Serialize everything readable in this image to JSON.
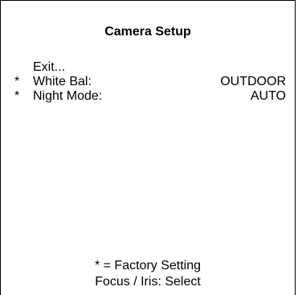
{
  "menu": {
    "title": "Camera Setup",
    "items": [
      {
        "marker": "",
        "label": "Exit...",
        "value": ""
      },
      {
        "marker": "*",
        "label": "White Bal:",
        "value": "OUTDOOR"
      },
      {
        "marker": "*",
        "label": "Night Mode:",
        "value": "AUTO"
      }
    ]
  },
  "footer": {
    "legend": "* = Factory Setting",
    "hint": "Focus / Iris: Select"
  }
}
